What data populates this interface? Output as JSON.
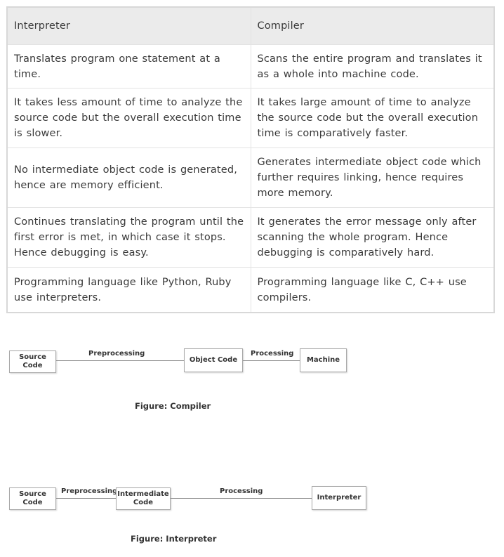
{
  "table": {
    "headers": [
      "Interpreter",
      "Compiler"
    ],
    "rows": [
      [
        "Translates program one statement at a time.",
        "Scans the entire program and translates it as a whole into machine code."
      ],
      [
        "It takes less amount of time to analyze the source code but the overall execution time is slower.",
        "It takes large amount of time to analyze the source code but the overall execution time is comparatively faster."
      ],
      [
        "No intermediate object code is generated, hence are memory efficient.",
        "Generates intermediate object code which further requires linking, hence requires more memory."
      ],
      [
        "Continues translating the program until the first error is met, in which case it stops. Hence debugging is easy.",
        "It generates the error message only after scanning the whole program. Hence debugging is comparatively hard."
      ],
      [
        "Programming language like Python, Ruby use interpreters.",
        "Programming language like C, C++ use compilers."
      ]
    ]
  },
  "compiler_figure": {
    "nodes": {
      "source": "Source Code",
      "object": "Object Code",
      "machine": "Machine"
    },
    "edges": {
      "preprocessing": "Preprocessing",
      "processing": "Processing"
    },
    "caption": "Figure: Compiler"
  },
  "interpreter_figure": {
    "nodes": {
      "source": "Source Code",
      "intermediate": "Intermediate Code",
      "interpreter": "Interpreter"
    },
    "edges": {
      "preprocessing": "Preprocessing",
      "processing": "Processing"
    },
    "caption": "Figure: Interpreter"
  }
}
